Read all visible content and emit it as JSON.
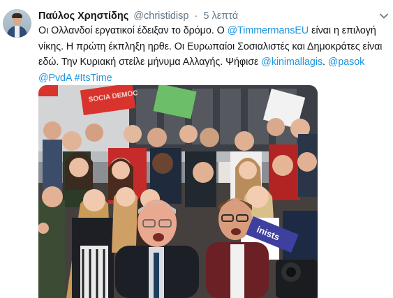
{
  "tweet": {
    "author_name": "Παύλος Χρηστίδης",
    "author_handle": "@christidisp",
    "separator": "·",
    "timestamp": "5 λεπτά",
    "lines": [
      [
        {
          "text": "Οι Ολλανδοί εργατικοί έδειξαν το δρόμο. Ο ",
          "link": false
        },
        {
          "text": "@TimmermansEU",
          "link": true
        },
        {
          "text": " είναι η επιλογή",
          "link": false
        }
      ],
      [
        {
          "text": "νίκης. Η πρώτη έκπληξη ηρθε. Οι Ευρωπαίοι Σοσιαλιστές και Δημοκράτες είναι",
          "link": false
        }
      ],
      [
        {
          "text": "εδώ. Την Κυριακή στείλε μήνυμα Αλλαγής. Ψήφισε ",
          "link": false
        },
        {
          "text": "@kinimallagis",
          "link": true
        },
        {
          "text": ". ",
          "link": false
        },
        {
          "text": "@pasok",
          "link": true
        }
      ],
      [
        {
          "text": "@PvdA",
          "link": true
        },
        {
          "text": " ",
          "link": false
        },
        {
          "text": "#ItsTime",
          "link": true
        }
      ]
    ],
    "photo": {
      "banner_red_text": "SOCIA DEMOC",
      "banner_blue_text": "inists"
    }
  },
  "colors": {
    "link": "#1b95e0",
    "text": "#14171a",
    "muted": "#657786"
  },
  "icons": {
    "caret": "chevron-down-icon"
  }
}
